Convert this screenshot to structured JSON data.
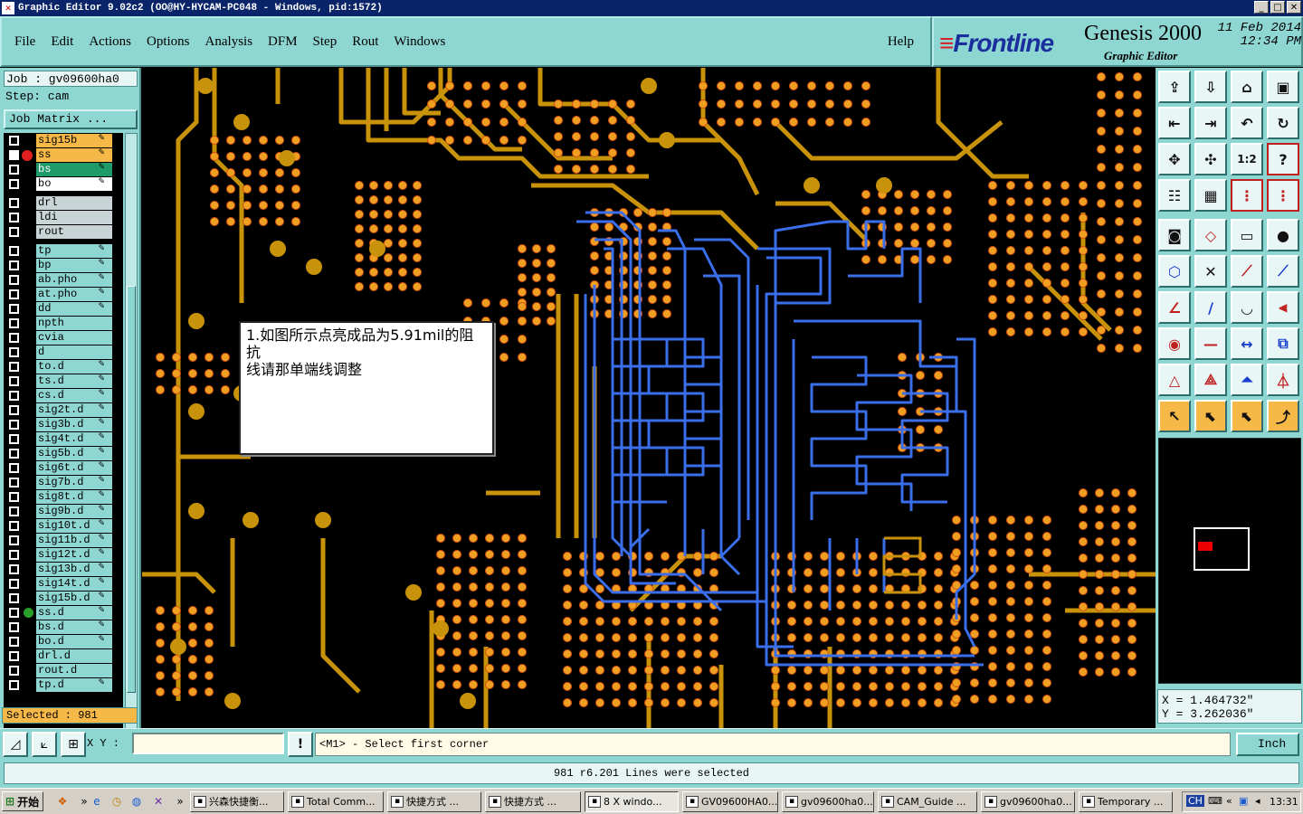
{
  "window": {
    "title": "Graphic Editor 9.02c2 (OO@HY-HYCAM-PC048 - Windows, pid:1572)"
  },
  "menu": {
    "items": [
      "File",
      "Edit",
      "Actions",
      "Options",
      "Analysis",
      "DFM",
      "Step",
      "Rout",
      "Windows"
    ],
    "help": "Help"
  },
  "brand": {
    "logo": "Frontline",
    "product": "Genesis 2000",
    "subtitle": "Graphic Editor",
    "date": "11 Feb 2014",
    "time": "12:34 PM"
  },
  "job": {
    "job_label": "Job : gv09600ha0",
    "step_label": "Step: cam",
    "matrix_button": "Job Matrix ..."
  },
  "layers": [
    {
      "name": "sig15b",
      "color": "#f6b847",
      "edit": true
    },
    {
      "name": "ss",
      "color": "#f6b847",
      "edit": true
    },
    {
      "name": "bs",
      "color": "#1f9a6a",
      "edit": true
    },
    {
      "name": "bo",
      "color": "#ffffff",
      "edit": true
    },
    {
      "name": "drl",
      "color": "#c8d4d6",
      "edit": false
    },
    {
      "name": "ldi",
      "color": "#c8d4d6",
      "edit": false
    },
    {
      "name": "rout",
      "color": "#c8d4d6",
      "edit": false
    },
    {
      "name": "tp",
      "color": "#8ed6d2",
      "edit": true
    },
    {
      "name": "bp",
      "color": "#8ed6d2",
      "edit": true
    },
    {
      "name": "ab.pho",
      "color": "#8ed6d2",
      "edit": true
    },
    {
      "name": "at.pho",
      "color": "#8ed6d2",
      "edit": true
    },
    {
      "name": "dd",
      "color": "#8ed6d2",
      "edit": true
    },
    {
      "name": "npth",
      "color": "#8ed6d2",
      "edit": false
    },
    {
      "name": "cvia",
      "color": "#8ed6d2",
      "edit": false
    },
    {
      "name": "d",
      "color": "#8ed6d2",
      "edit": false
    },
    {
      "name": "to.d",
      "color": "#8ed6d2",
      "edit": true
    },
    {
      "name": "ts.d",
      "color": "#8ed6d2",
      "edit": true
    },
    {
      "name": "cs.d",
      "color": "#8ed6d2",
      "edit": true
    },
    {
      "name": "sig2t.d",
      "color": "#8ed6d2",
      "edit": true
    },
    {
      "name": "sig3b.d",
      "color": "#8ed6d2",
      "edit": true
    },
    {
      "name": "sig4t.d",
      "color": "#8ed6d2",
      "edit": true
    },
    {
      "name": "sig5b.d",
      "color": "#8ed6d2",
      "edit": true
    },
    {
      "name": "sig6t.d",
      "color": "#8ed6d2",
      "edit": true
    },
    {
      "name": "sig7b.d",
      "color": "#8ed6d2",
      "edit": true
    },
    {
      "name": "sig8t.d",
      "color": "#8ed6d2",
      "edit": true
    },
    {
      "name": "sig9b.d",
      "color": "#8ed6d2",
      "edit": true
    },
    {
      "name": "sig10t.d",
      "color": "#8ed6d2",
      "edit": true
    },
    {
      "name": "sig11b.d",
      "color": "#8ed6d2",
      "edit": true
    },
    {
      "name": "sig12t.d",
      "color": "#8ed6d2",
      "edit": true
    },
    {
      "name": "sig13b.d",
      "color": "#8ed6d2",
      "edit": true
    },
    {
      "name": "sig14t.d",
      "color": "#8ed6d2",
      "edit": true
    },
    {
      "name": "sig15b.d",
      "color": "#8ed6d2",
      "edit": true
    },
    {
      "name": "ss.d",
      "color": "#8ed6d2",
      "edit": true
    },
    {
      "name": "bs.d",
      "color": "#8ed6d2",
      "edit": true
    },
    {
      "name": "bo.d",
      "color": "#8ed6d2",
      "edit": true
    },
    {
      "name": "drl.d",
      "color": "#8ed6d2",
      "edit": false
    },
    {
      "name": "rout.d",
      "color": "#8ed6d2",
      "edit": false
    },
    {
      "name": "tp.d",
      "color": "#8ed6d2",
      "edit": true
    }
  ],
  "selected_label": "Selected : 981",
  "annotation": {
    "line1": "1.如图所示点亮成品为5.91mil的阻抗",
    "line2": "线请那单端线调整"
  },
  "coords": {
    "x": "X = 1.464732\"",
    "y": "Y = 3.262036\""
  },
  "bottom": {
    "xy_label": "X Y :",
    "xy_value": "",
    "prompt": "<M1> - Select first corner",
    "unit": "Inch"
  },
  "status": {
    "message": "981 r6.201 Lines were selected"
  },
  "taskbar": {
    "start": "开始",
    "tasks": [
      "兴森快捷衡...",
      "Total Comm...",
      "快捷方式 ...",
      "快捷方式 ...",
      "8 X windo...",
      "GV09600HA0...",
      "gv09600ha0...",
      "CAM_Guide ...",
      "gv09600ha0...",
      "Temporary ..."
    ],
    "lang": "CH",
    "clock": "13:31"
  },
  "colors": {
    "copper": "#c8920a",
    "pad": "#f0a020",
    "trace_selected": "#3a6eea",
    "panel": "#8ed6d2"
  }
}
